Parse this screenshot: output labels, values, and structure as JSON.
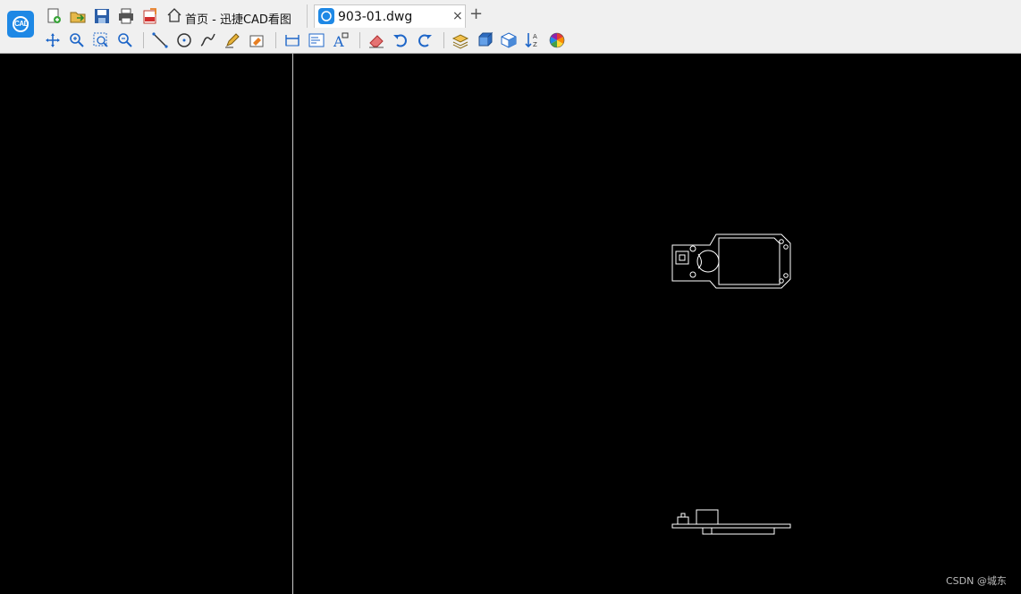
{
  "app": {
    "logo_text": "CAD"
  },
  "tabs": {
    "home_label": "首页 - 迅捷CAD看图",
    "file_label": "903-01.dwg",
    "close_glyph": "×",
    "new_tab_glyph": "+"
  },
  "toolbar": {
    "row1_icons": [
      "new-file-icon",
      "open-folder-icon",
      "save-icon",
      "print-icon",
      "export-pdf-icon"
    ],
    "row2_icons": [
      "pan-icon",
      "zoom-realtime-icon",
      "zoom-window-icon",
      "zoom-extents-icon",
      "line-icon",
      "circle-icon",
      "polyline-icon",
      "pencil-icon",
      "eraser-draw-icon",
      "dimension-icon",
      "layout-icon",
      "text-icon",
      "eraser-icon",
      "undo-icon",
      "redo-icon",
      "layers-icon",
      "3d-box-icon",
      "3d-view-icon",
      "sort-icon",
      "color-wheel-icon"
    ]
  },
  "colors": {
    "canvas_bg": "#000000",
    "drawing_stroke": "#ffffff",
    "accent": "#1e88e5"
  },
  "watermark": "CSDN @城东"
}
